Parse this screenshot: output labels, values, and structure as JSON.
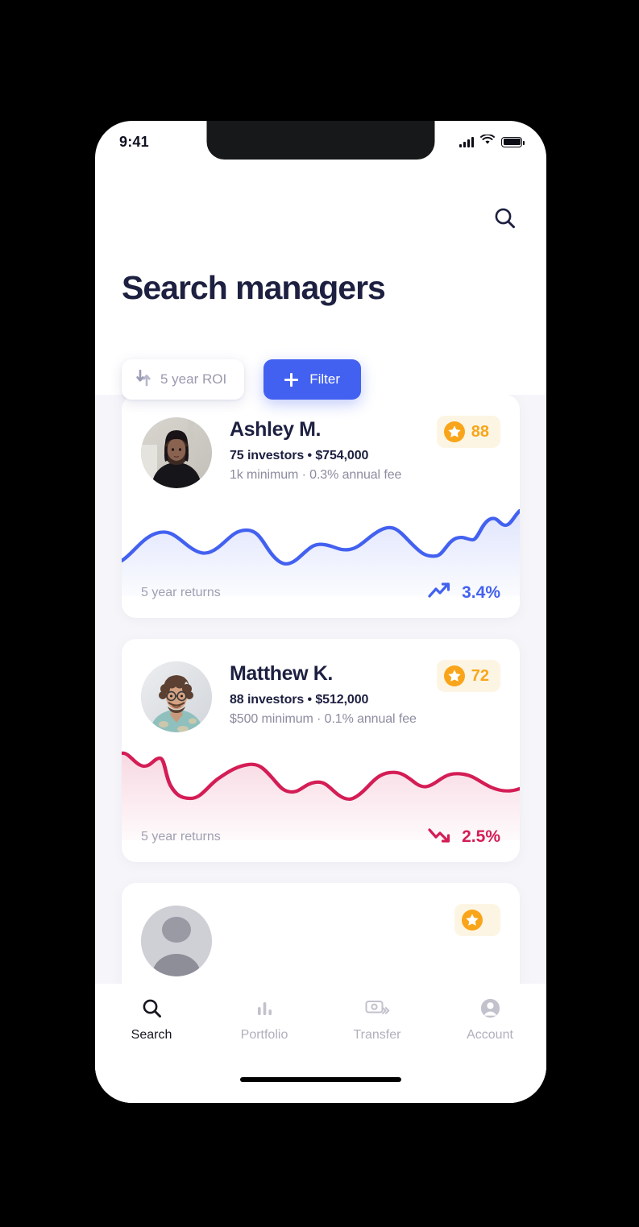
{
  "status_bar": {
    "time": "9:41",
    "signal_icon": "cellular-bars-icon",
    "wifi_icon": "wifi-icon",
    "battery_icon": "battery-full-icon"
  },
  "header": {
    "title": "Search managers",
    "search_icon": "search-icon"
  },
  "filters": {
    "sort": {
      "icon": "sort-arrows-icon",
      "label": "5 year ROI"
    },
    "filter_button": {
      "icon": "plus-icon",
      "label": "Filter"
    }
  },
  "colors": {
    "accent_blue": "#4361f0",
    "down_red": "#d41d56",
    "rating_orange": "#f9a51a",
    "rating_badge_bg": "#fdf5e3",
    "title_navy": "#1d2040",
    "page_bg": "#f6f6fa"
  },
  "managers": [
    {
      "name": "Ashley M.",
      "stats": "75 investors • $754,000",
      "terms": "1k minimum · 0.3% annual fee",
      "rating": "88",
      "rating_icon": "star-icon",
      "avatar": "avatar-ashley",
      "chart_caption": "5 year returns",
      "change": "3.4%",
      "direction": "up",
      "trend_icon": "trend-up-icon"
    },
    {
      "name": "Matthew K.",
      "stats": "88 investors • $512,000",
      "terms": "$500 minimum · 0.1% annual fee",
      "rating": "72",
      "rating_icon": "star-icon",
      "avatar": "avatar-matthew",
      "chart_caption": "5 year returns",
      "change": "2.5%",
      "direction": "down",
      "trend_icon": "trend-down-icon"
    },
    {
      "name": "",
      "stats": "",
      "terms": "",
      "rating": "",
      "rating_icon": "star-icon",
      "avatar": "avatar-partial",
      "chart_caption": "",
      "change": "",
      "direction": "up",
      "trend_icon": "trend-up-icon"
    }
  ],
  "chart_data": [
    {
      "type": "area",
      "title": "5 year returns",
      "series_name": "Ashley M. 5 year returns",
      "color": "#4361f0",
      "change_label": "3.4%",
      "trend": "up",
      "x": [
        0,
        1,
        2,
        3,
        4,
        5,
        6,
        7,
        8,
        9,
        10,
        11,
        12,
        13,
        14,
        15,
        16,
        17,
        18,
        19,
        20,
        21,
        22
      ],
      "values": [
        30,
        48,
        58,
        57,
        44,
        40,
        52,
        60,
        57,
        38,
        30,
        36,
        46,
        44,
        42,
        50,
        62,
        66,
        52,
        38,
        40,
        62,
        57,
        75,
        78
      ],
      "xlabel": "",
      "ylabel": "",
      "grid": false,
      "legend": "none"
    },
    {
      "type": "area",
      "title": "5 year returns",
      "series_name": "Matthew K. 5 year returns",
      "color": "#d41d56",
      "change_label": "2.5%",
      "trend": "down",
      "x": [
        0,
        1,
        2,
        3,
        4,
        5,
        6,
        7,
        8,
        9,
        10,
        11,
        12,
        13,
        14,
        15,
        16,
        17,
        18,
        19,
        20,
        21,
        22
      ],
      "values": [
        82,
        72,
        70,
        76,
        56,
        42,
        40,
        50,
        62,
        70,
        68,
        56,
        52,
        58,
        60,
        46,
        44,
        58,
        66,
        64,
        56,
        60,
        62,
        52
      ],
      "xlabel": "",
      "ylabel": "",
      "grid": false,
      "legend": "none"
    }
  ],
  "tabs": [
    {
      "label": "Search",
      "icon": "search-icon",
      "active": true
    },
    {
      "label": "Portfolio",
      "icon": "bar-chart-icon",
      "active": false
    },
    {
      "label": "Transfer",
      "icon": "transfer-icon",
      "active": false
    },
    {
      "label": "Account",
      "icon": "person-icon",
      "active": false
    }
  ]
}
